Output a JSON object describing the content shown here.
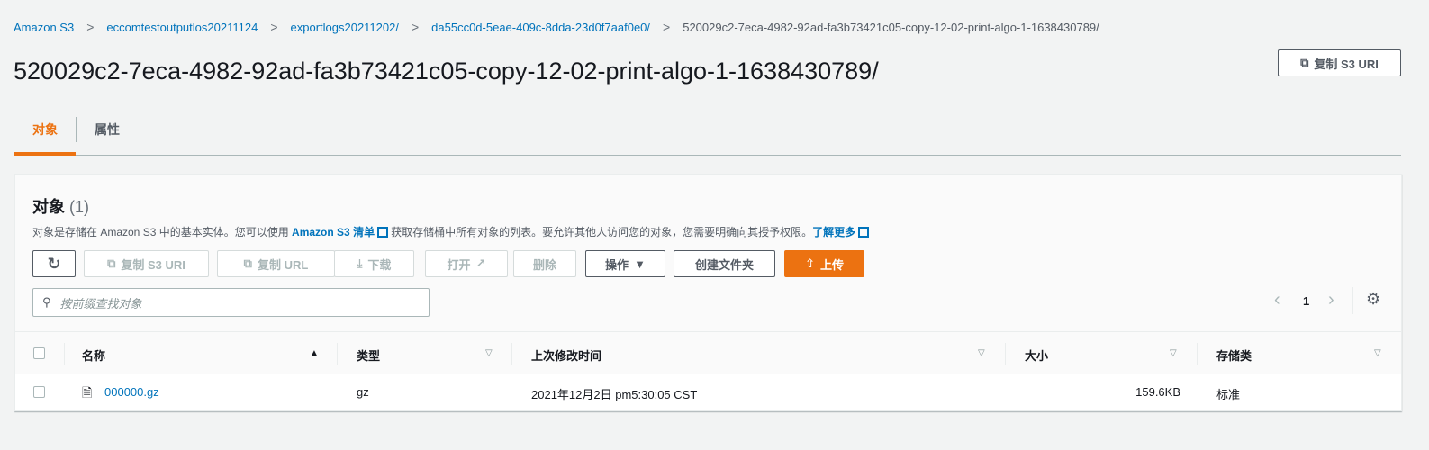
{
  "breadcrumb": [
    "Amazon S3",
    "eccomtestoutputlos20211124",
    "exportlogs20211202/",
    "da55cc0d-5eae-409c-8dda-23d0f7aaf0e0/",
    "520029c2-7eca-4982-92ad-fa3b73421c05-copy-12-02-print-algo-1-1638430789/"
  ],
  "title": "520029c2-7eca-4982-92ad-fa3b73421c05-copy-12-02-print-algo-1-1638430789/",
  "copy_uri": "复制 S3 URI",
  "tabs": [
    "对象",
    "属性"
  ],
  "panel": {
    "title": "对象",
    "count": "(1)",
    "desc1": "对象是存储在 Amazon S3 中的基本实体。您可以使用 ",
    "desc_link": "Amazon S3 清单",
    "desc2": "获取存储桶中所有对象的列表。要允许其他人访问您的对象，您需要明确向其授予权限。",
    "learn_more": "了解更多",
    "buttons": {
      "copy_uri": "复制 S3 URI",
      "copy_url": "复制 URL",
      "download": "下载",
      "open": "打开",
      "delete": "删除",
      "actions": "操作",
      "create_folder": "创建文件夹",
      "upload": "上传"
    },
    "search_placeholder": "按前缀查找对象",
    "page": "1",
    "columns": [
      "名称",
      "类型",
      "上次修改时间",
      "大小",
      "存储类"
    ],
    "rows": [
      {
        "name": "000000.gz",
        "type": "gz",
        "modified": "2021年12月2日 pm5:30:05 CST",
        "size": "159.6KB",
        "storage": "标准"
      }
    ]
  },
  "colors": {
    "accent": "#ec7211",
    "link": "#0073bb"
  }
}
